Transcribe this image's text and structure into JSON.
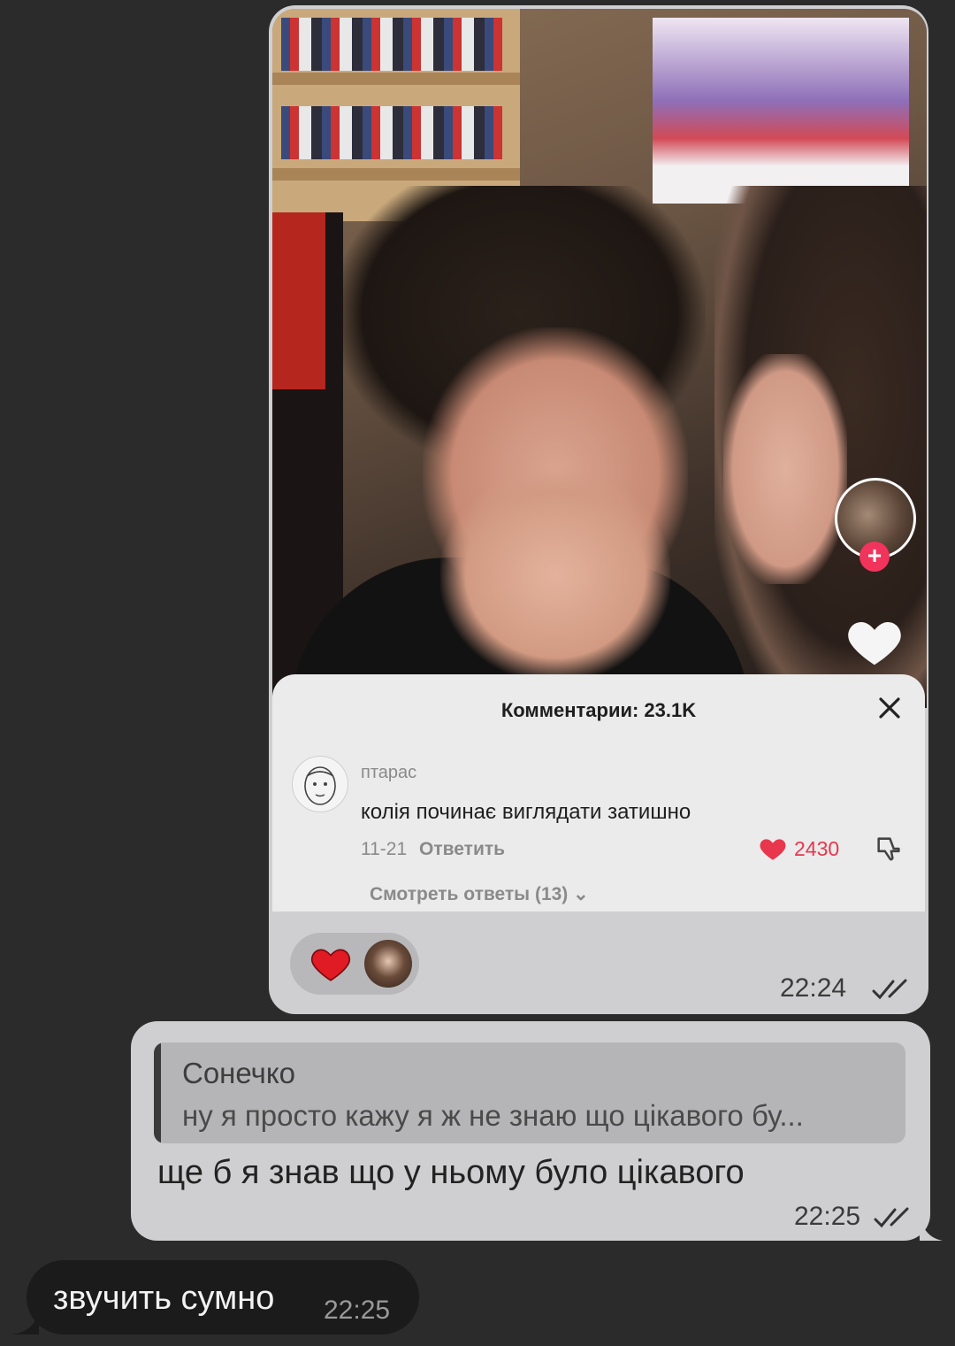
{
  "media_message": {
    "tiktok": {
      "comments_title": "Комментарии: 23.1K",
      "comment": {
        "user": "птарас",
        "text": "колія починає виглядати затишно",
        "date": "11-21",
        "reply_label": "Ответить",
        "likes": "2430",
        "view_replies": "Смотреть ответы (13)"
      }
    },
    "reaction_icon": "red-heart",
    "time": "22:24",
    "status_icon": "double-check"
  },
  "reply_message": {
    "quoted_name": "Сонечко",
    "quoted_text": "ну я просто кажу я ж не знаю що цікавого бу...",
    "text": "ще б я знав що у ньому було цікавого",
    "time": "22:25",
    "status_icon": "double-check"
  },
  "incoming_message": {
    "text": "звучить сумно",
    "time": "22:25"
  },
  "colors": {
    "background": "#2b2b2b",
    "outgoing_bubble": "#cfcfd1",
    "incoming_bubble": "#1b1b1b",
    "like_red": "#e8364d",
    "follow_pink": "#f0345c"
  }
}
